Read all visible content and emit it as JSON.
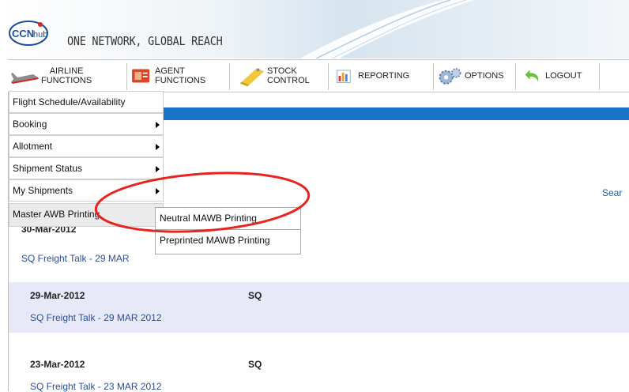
{
  "header": {
    "logo_text": "CCNhub",
    "tagline": "ONE NETWORK, GLOBAL REACH"
  },
  "menu": {
    "items": [
      {
        "label": "AIRLINE\nFUNCTIONS",
        "icon": "airplane-icon"
      },
      {
        "label": "AGENT\nFUNCTIONS",
        "icon": "agent-card-icon"
      },
      {
        "label": "STOCK\nCONTROL",
        "icon": "stock-icon"
      },
      {
        "label": "REPORTING",
        "icon": "bar-chart-icon"
      },
      {
        "label": "OPTIONS",
        "icon": "gears-icon"
      },
      {
        "label": "LOGOUT",
        "icon": "back-arrow-icon"
      }
    ]
  },
  "dropdown": {
    "items": [
      {
        "label": "Flight Schedule/Availability",
        "has_submenu": false
      },
      {
        "label": "Booking",
        "has_submenu": true
      },
      {
        "label": "Allotment",
        "has_submenu": true
      },
      {
        "label": "Shipment Status",
        "has_submenu": true
      },
      {
        "label": "My Shipments",
        "has_submenu": true
      },
      {
        "label": "Master AWB Printing",
        "has_submenu": false
      }
    ],
    "submenu": [
      {
        "label": "Neutral MAWB Printing"
      },
      {
        "label": "Preprinted MAWB Printing"
      }
    ]
  },
  "content": {
    "search_partial": "Sear",
    "partial_date": "30-Mar-2012",
    "news": [
      {
        "date": "",
        "source": "",
        "link": "SQ Freight Talk - 29 MAR"
      },
      {
        "date": "29-Mar-2012",
        "source": "SQ",
        "link": "SQ Freight Talk - 29 MAR 2012"
      },
      {
        "date": "23-Mar-2012",
        "source": "SQ",
        "link": "SQ Freight Talk - 23 MAR 2012"
      }
    ]
  },
  "colors": {
    "blue_bar": "#1a74c9",
    "row_shade": "#e8e9f8",
    "link": "#2b4f99",
    "annotation": "#e8231f"
  }
}
